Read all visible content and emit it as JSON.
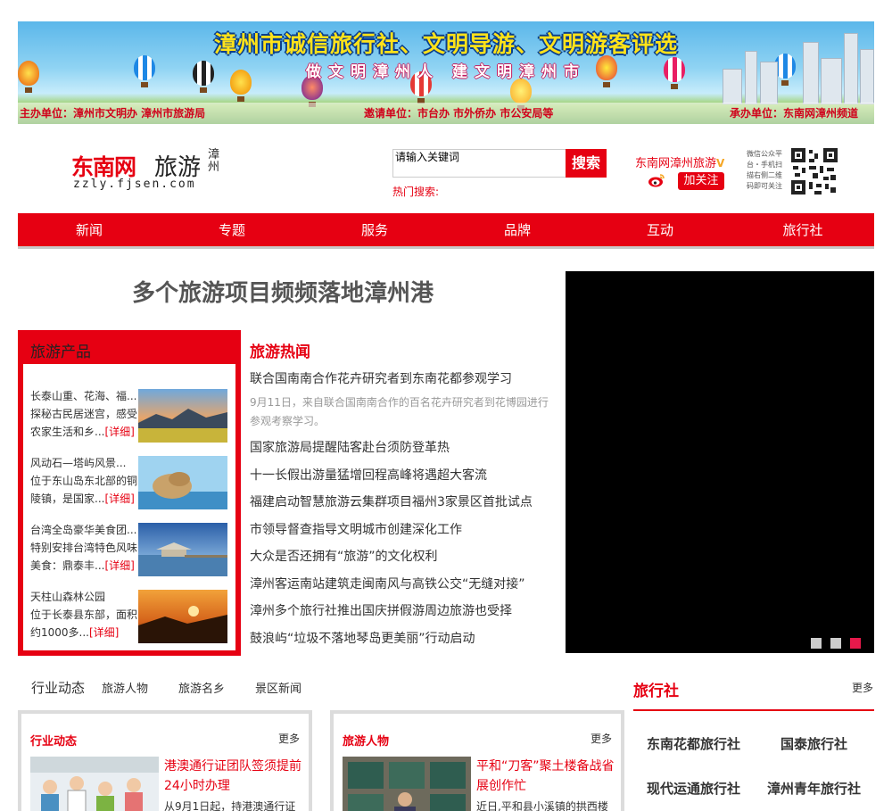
{
  "banner": {
    "title": "漳州市诚信旅行社、文明导游、文明游客评选",
    "subtitle": "做文明漳州人 建文明漳州市",
    "organizer": "主办单位：漳州市文明办  漳州市旅游局",
    "invited": "邀请单位：市台办  市外侨办  市公安局等",
    "host": "承办单位：东南网漳州频道"
  },
  "logo": {
    "brand": "东南网",
    "section": "旅游",
    "city": "漳州",
    "domain": "zzly.fjsen.com"
  },
  "search": {
    "placeholder": "请输入关键词",
    "button": "搜索",
    "hot_label": "热门搜索:"
  },
  "weibo": {
    "name": "东南网漳州旅游",
    "verified": "V",
    "follow": "加关注",
    "wechat_note": "微信公众平台・手机扫描右侧二维码即可关注"
  },
  "nav": [
    "新闻",
    "专题",
    "服务",
    "品牌",
    "互动",
    "旅行社"
  ],
  "headline": "多个旅游项目频频落地漳州港",
  "products": {
    "title": "旅游产品",
    "more_label": "[详细]",
    "items": [
      {
        "title": "长泰山重、花海、福...",
        "line2": "探秘古民居迷宫，感受",
        "line3": "农家生活和乡..."
      },
      {
        "title": "风动石—塔屿风景...",
        "line2": "位于东山岛东北部的铜",
        "line3": "陵镇，是国家..."
      },
      {
        "title": "台湾全岛豪华美食团...",
        "line2": "特别安排台湾特色风味",
        "line3": "美食：鼎泰丰..."
      },
      {
        "title": "天柱山森林公园",
        "line2": "位于长泰县东部，面积",
        "line3": "约1000多..."
      }
    ]
  },
  "hot_news": {
    "title": "旅游热闻",
    "lead": "联合国南南合作花卉研究者到东南花都参观学习",
    "summary": "9月11日，来自联合国南南合作的百名花卉研究者到花博园进行参观考察学习。",
    "items": [
      "国家旅游局提醒陆客赴台须防登革热",
      "十一长假出游量猛增回程高峰将遇超大客流",
      "福建启动智慧旅游云集群项目福州3家景区首批试点",
      "市领导督查指导文明城市创建深化工作",
      "大众是否还拥有“旅游”的文化权利",
      "漳州客运南站建筑走闽南风与高铁公交“无缝对接”",
      "漳州多个旅行社推出国庆拼假游周边旅游也受择",
      "鼓浪屿“垃圾不落地琴岛更美丽”行动启动"
    ]
  },
  "tabs": [
    "行业动态",
    "旅游人物",
    "旅游名乡",
    "景区新闻"
  ],
  "travel_agencies": {
    "title": "旅行社",
    "more": "更多",
    "items": [
      "东南花都旅行社",
      "国泰旅行社",
      "现代运通旅行社",
      "漳州青年旅行社"
    ]
  },
  "boxes": [
    {
      "title": "行业动态",
      "more": "更多",
      "headline": "港澳通行证团队签须提前24小时办理",
      "desc": "从9月1日起，持港澳通行证"
    },
    {
      "title": "旅游人物",
      "more": "更多",
      "headline": "平和“刀客”聚土楼备战省展创作忙",
      "desc": "近日,平和县小溪镇的拱西楼"
    }
  ],
  "colors": {
    "brand_red": "#e60012",
    "video_bg": "#000000"
  },
  "slider": {
    "dots": 3,
    "active_index": 2
  }
}
